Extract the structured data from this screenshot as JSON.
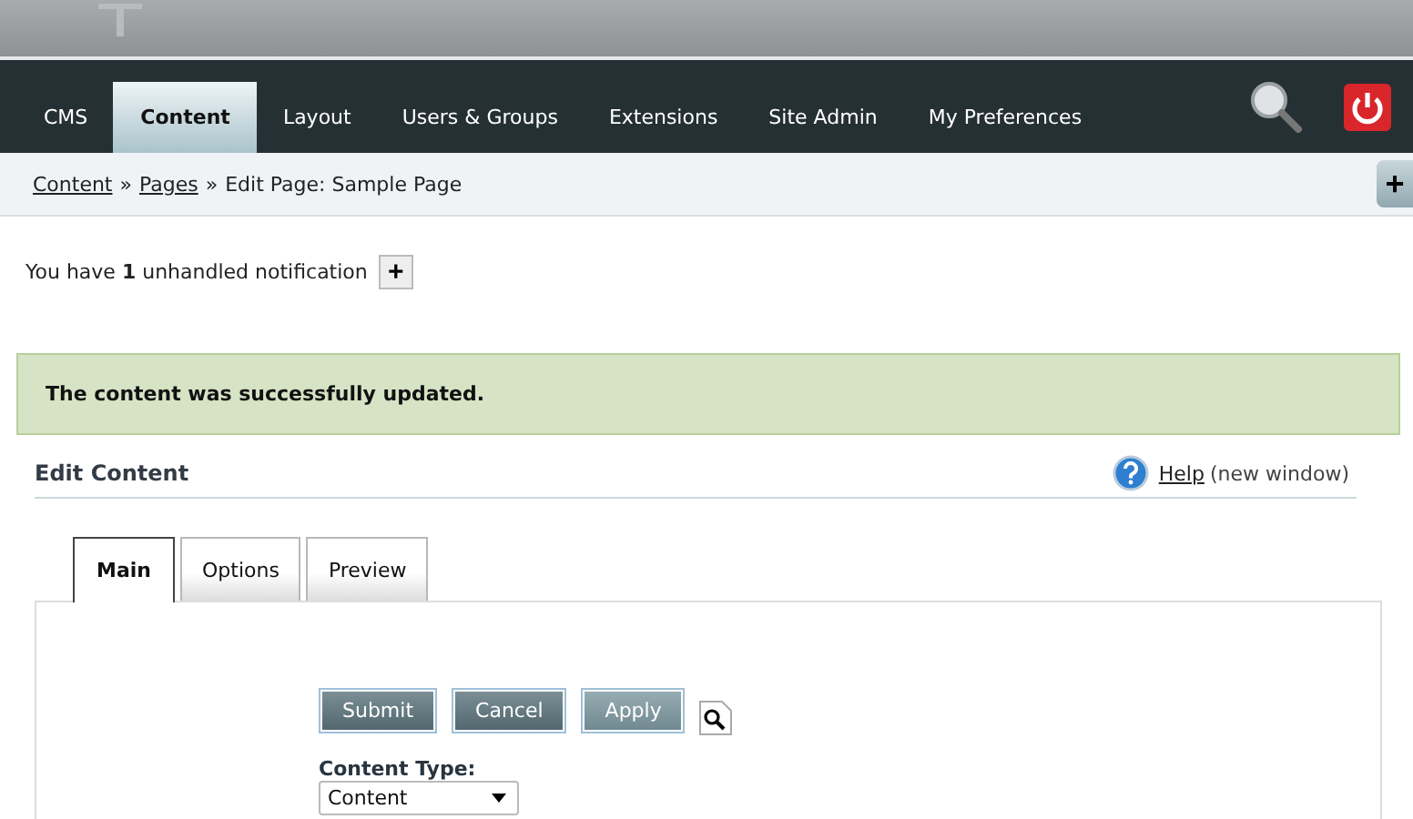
{
  "nav": {
    "items": [
      {
        "label": "CMS",
        "selected": false
      },
      {
        "label": "Content",
        "selected": true
      },
      {
        "label": "Layout",
        "selected": false
      },
      {
        "label": "Users & Groups",
        "selected": false
      },
      {
        "label": "Extensions",
        "selected": false
      },
      {
        "label": "Site Admin",
        "selected": false
      },
      {
        "label": "My Preferences",
        "selected": false
      }
    ]
  },
  "breadcrumb": {
    "links": [
      "Content",
      "Pages"
    ],
    "separator": "»",
    "current": "Edit Page: Sample Page",
    "add_button": "+"
  },
  "notification": {
    "text": "You have **1** unhandled notification",
    "button": "+"
  },
  "message": "The content was successfully updated.",
  "section": {
    "title": "Edit Content",
    "help_link": "Help",
    "help_note": "(new window)"
  },
  "tabs": [
    {
      "label": "Main",
      "selected": true
    },
    {
      "label": "Options",
      "selected": false
    },
    {
      "label": "Preview",
      "selected": false
    }
  ],
  "buttons": [
    {
      "label": "Submit",
      "disabled": false
    },
    {
      "label": "Cancel",
      "disabled": false
    },
    {
      "label": "Apply",
      "disabled": true
    }
  ],
  "content_type": {
    "label": "Content Type:",
    "value": "Content"
  }
}
